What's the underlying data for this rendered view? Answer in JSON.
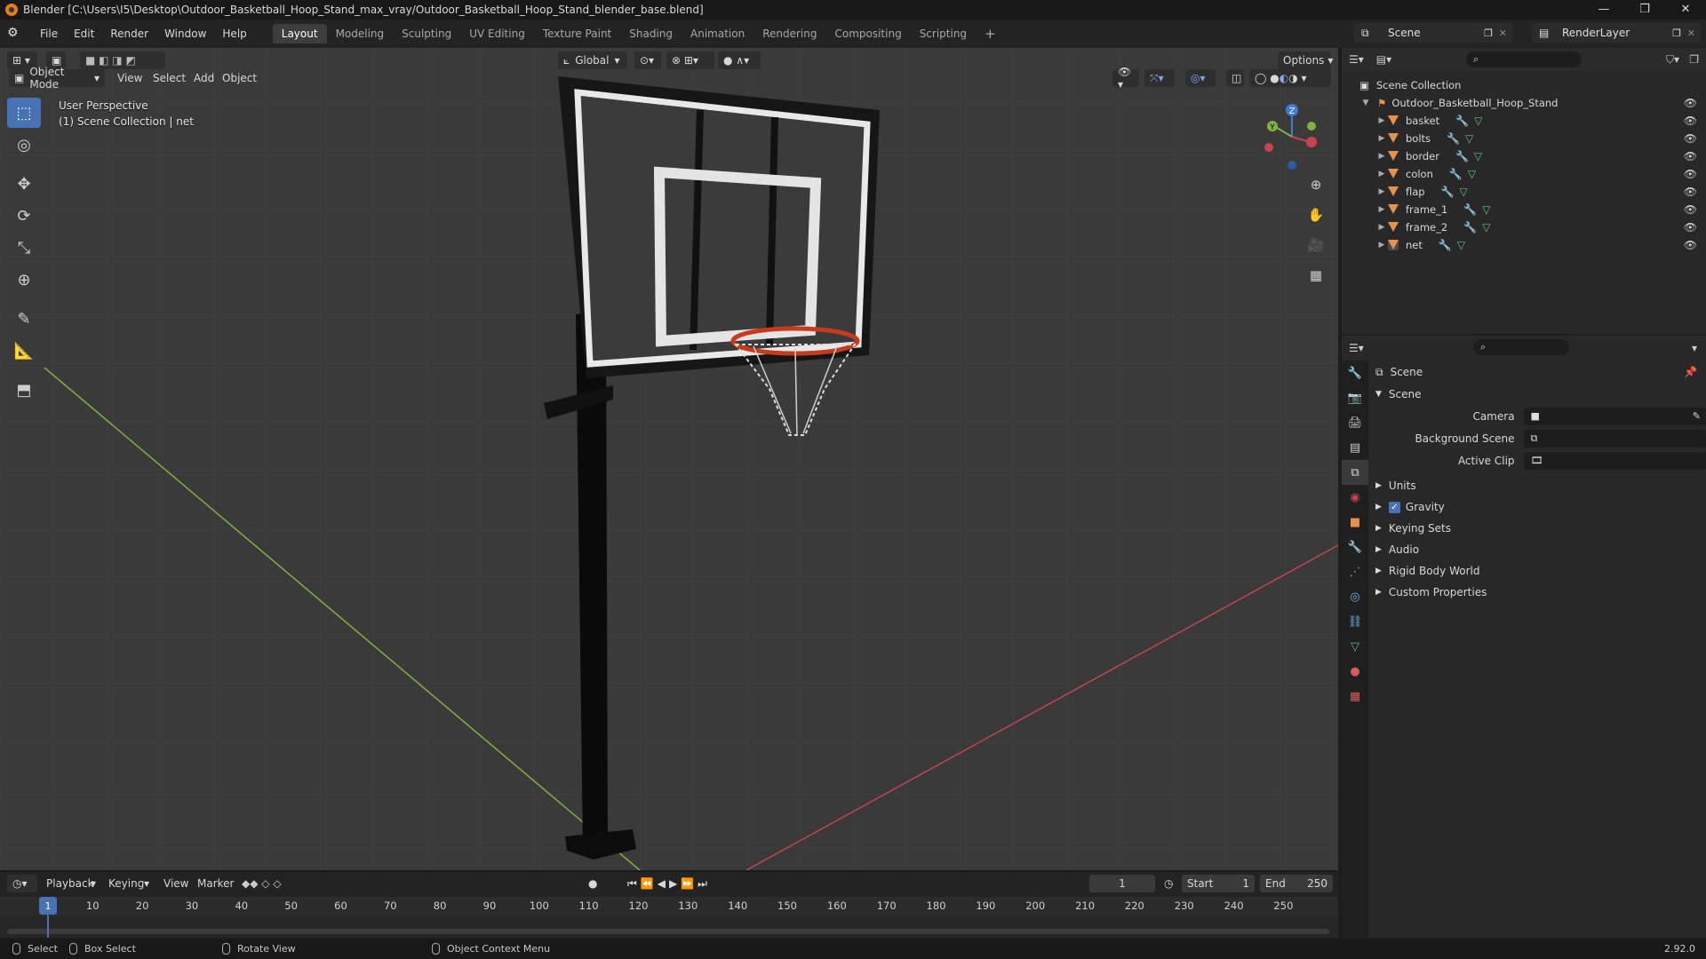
{
  "window": {
    "title": "Blender [C:\\Users\\I5\\Desktop\\Outdoor_Basketball_Hoop_Stand_max_vray/Outdoor_Basketball_Hoop_Stand_blender_base.blend]",
    "controls": [
      "—",
      "❐",
      "✕"
    ]
  },
  "menus": [
    "File",
    "Edit",
    "Render",
    "Window",
    "Help"
  ],
  "workspaces": [
    "Layout",
    "Modeling",
    "Sculpting",
    "UV Editing",
    "Texture Paint",
    "Shading",
    "Animation",
    "Rendering",
    "Compositing",
    "Scripting"
  ],
  "scene_name": "Scene",
  "render_layer": "RenderLayer",
  "viewport": {
    "transform_orientation": "Global",
    "options_label": "Options",
    "mode": "Object Mode",
    "menus": [
      "View",
      "Select",
      "Add",
      "Object"
    ],
    "info_line1": "User Perspective",
    "info_line2": "(1) Scene Collection | net",
    "gizmo": {
      "x": "X",
      "y": "Y",
      "z": "Z"
    }
  },
  "outliner": {
    "root": "Scene Collection",
    "collection": "Outdoor_Basketball_Hoop_Stand",
    "objects": [
      "basket",
      "bolts",
      "border",
      "colon",
      "flap",
      "frame_1",
      "frame_2",
      "net"
    ]
  },
  "properties": {
    "header": "Scene",
    "section": "Scene",
    "fields": {
      "camera": "Camera",
      "background_scene": "Background Scene",
      "active_clip": "Active Clip"
    },
    "panels": [
      "Units",
      "Gravity",
      "Keying Sets",
      "Audio",
      "Rigid Body World",
      "Custom Properties"
    ],
    "gravity_checked": true
  },
  "timeline": {
    "menus": [
      "Playback",
      "Keying",
      "View",
      "Marker"
    ],
    "current_frame": "1",
    "start_label": "Start",
    "start": "1",
    "end_label": "End",
    "end": "250",
    "ticks": [
      "10",
      "20",
      "30",
      "40",
      "50",
      "60",
      "70",
      "80",
      "90",
      "100",
      "110",
      "120",
      "130",
      "140",
      "150",
      "160",
      "170",
      "180",
      "190",
      "200",
      "210",
      "220",
      "230",
      "240",
      "250"
    ],
    "playhead_label": "1"
  },
  "statusbar": {
    "select": "Select",
    "box_select": "Box Select",
    "rotate_view": "Rotate View",
    "context_menu": "Object Context Menu",
    "version": "2.92.0"
  },
  "colors": {
    "accent": "#4772b3",
    "x_axis": "#c8434f",
    "y_axis": "#7fb33b",
    "z_axis": "#3b7cd6",
    "rim": "#c83a1c"
  }
}
